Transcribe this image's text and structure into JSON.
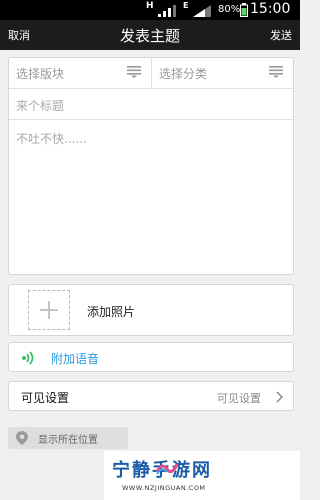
{
  "status_bar": {
    "signal_h": "H",
    "signal_e": "E",
    "battery": "80%",
    "time": "15:00"
  },
  "nav": {
    "cancel": "取消",
    "title": "发表主题",
    "send": "发送"
  },
  "compose": {
    "board_select_placeholder": "选择版块",
    "category_select_placeholder": "选择分类",
    "title_placeholder": "来个标题",
    "body_placeholder": "不吐不快......"
  },
  "attachments": {
    "add_photo_label": "添加照片",
    "add_voice_label": "附加语音"
  },
  "visibility": {
    "label": "可见设置",
    "value": "可见设置"
  },
  "location": {
    "label": "显示所在位置"
  },
  "watermark": {
    "text": "宁静手游网",
    "url": "WWW.NZJINGUAN.COM"
  },
  "colors": {
    "accent": "#2a9be0",
    "nav_background": "#1c1c1c",
    "page_background": "#f0f0f0"
  }
}
